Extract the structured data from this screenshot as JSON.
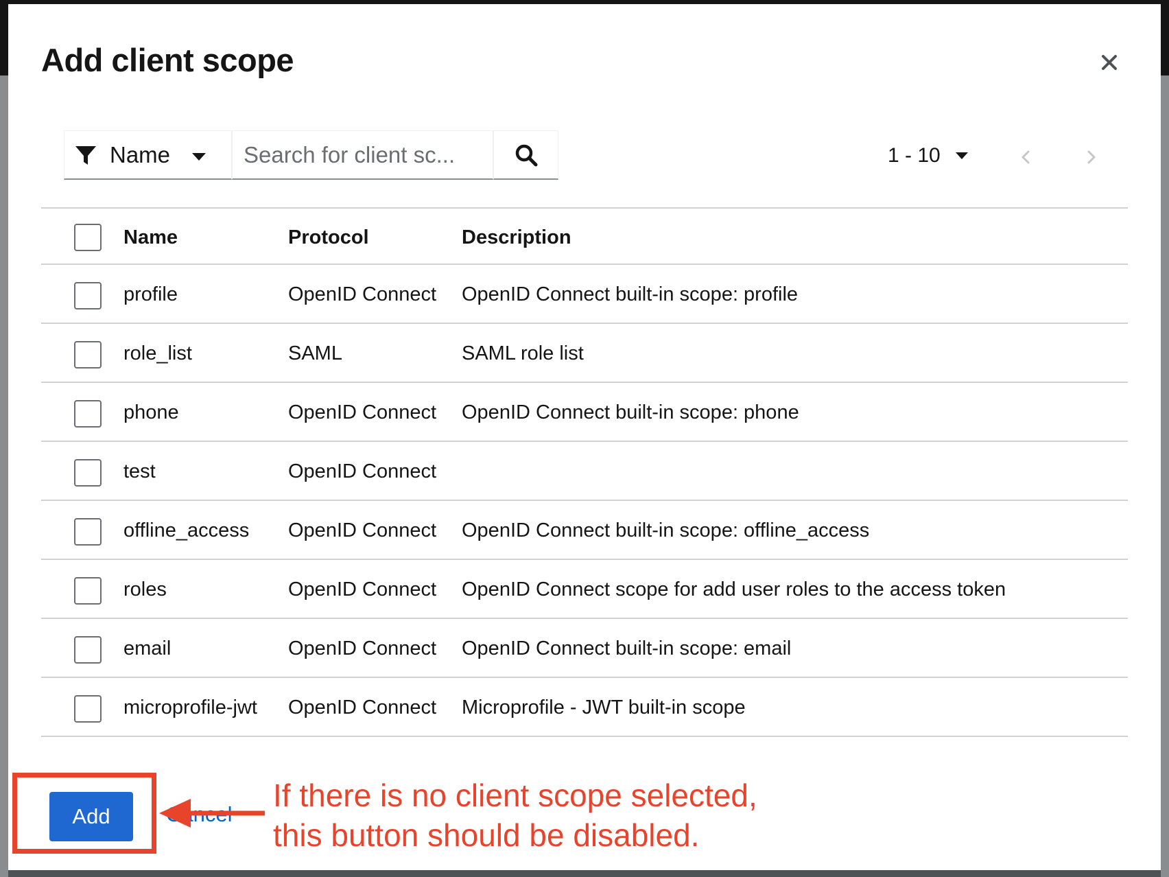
{
  "modal": {
    "title": "Add client scope"
  },
  "toolbar": {
    "filter_label": "Name",
    "search_placeholder": "Search for client sc...",
    "pagination_range": "1 - 10"
  },
  "table": {
    "headers": {
      "name": "Name",
      "protocol": "Protocol",
      "description": "Description"
    },
    "rows": [
      {
        "name": "profile",
        "protocol": "OpenID Connect",
        "description": "OpenID Connect built-in scope: profile"
      },
      {
        "name": "role_list",
        "protocol": "SAML",
        "description": "SAML role list"
      },
      {
        "name": "phone",
        "protocol": "OpenID Connect",
        "description": "OpenID Connect built-in scope: phone"
      },
      {
        "name": "test",
        "protocol": "OpenID Connect",
        "description": ""
      },
      {
        "name": "offline_access",
        "protocol": "OpenID Connect",
        "description": "OpenID Connect built-in scope: offline_access"
      },
      {
        "name": "roles",
        "protocol": "OpenID Connect",
        "description": "OpenID Connect scope for add user roles to the access token"
      },
      {
        "name": "email",
        "protocol": "OpenID Connect",
        "description": "OpenID Connect built-in scope: email"
      },
      {
        "name": "microprofile-jwt",
        "protocol": "OpenID Connect",
        "description": "Microprofile - JWT built-in scope"
      }
    ]
  },
  "footer": {
    "add_label": "Add",
    "cancel_label": "Cancel"
  },
  "annotation": {
    "line1": "If there is no client scope selected,",
    "line2": "this button should be disabled.",
    "color": "#e8432b"
  },
  "colors": {
    "primary": "#1f68d1",
    "link": "#0066cc",
    "border": "#d2d2d2"
  }
}
